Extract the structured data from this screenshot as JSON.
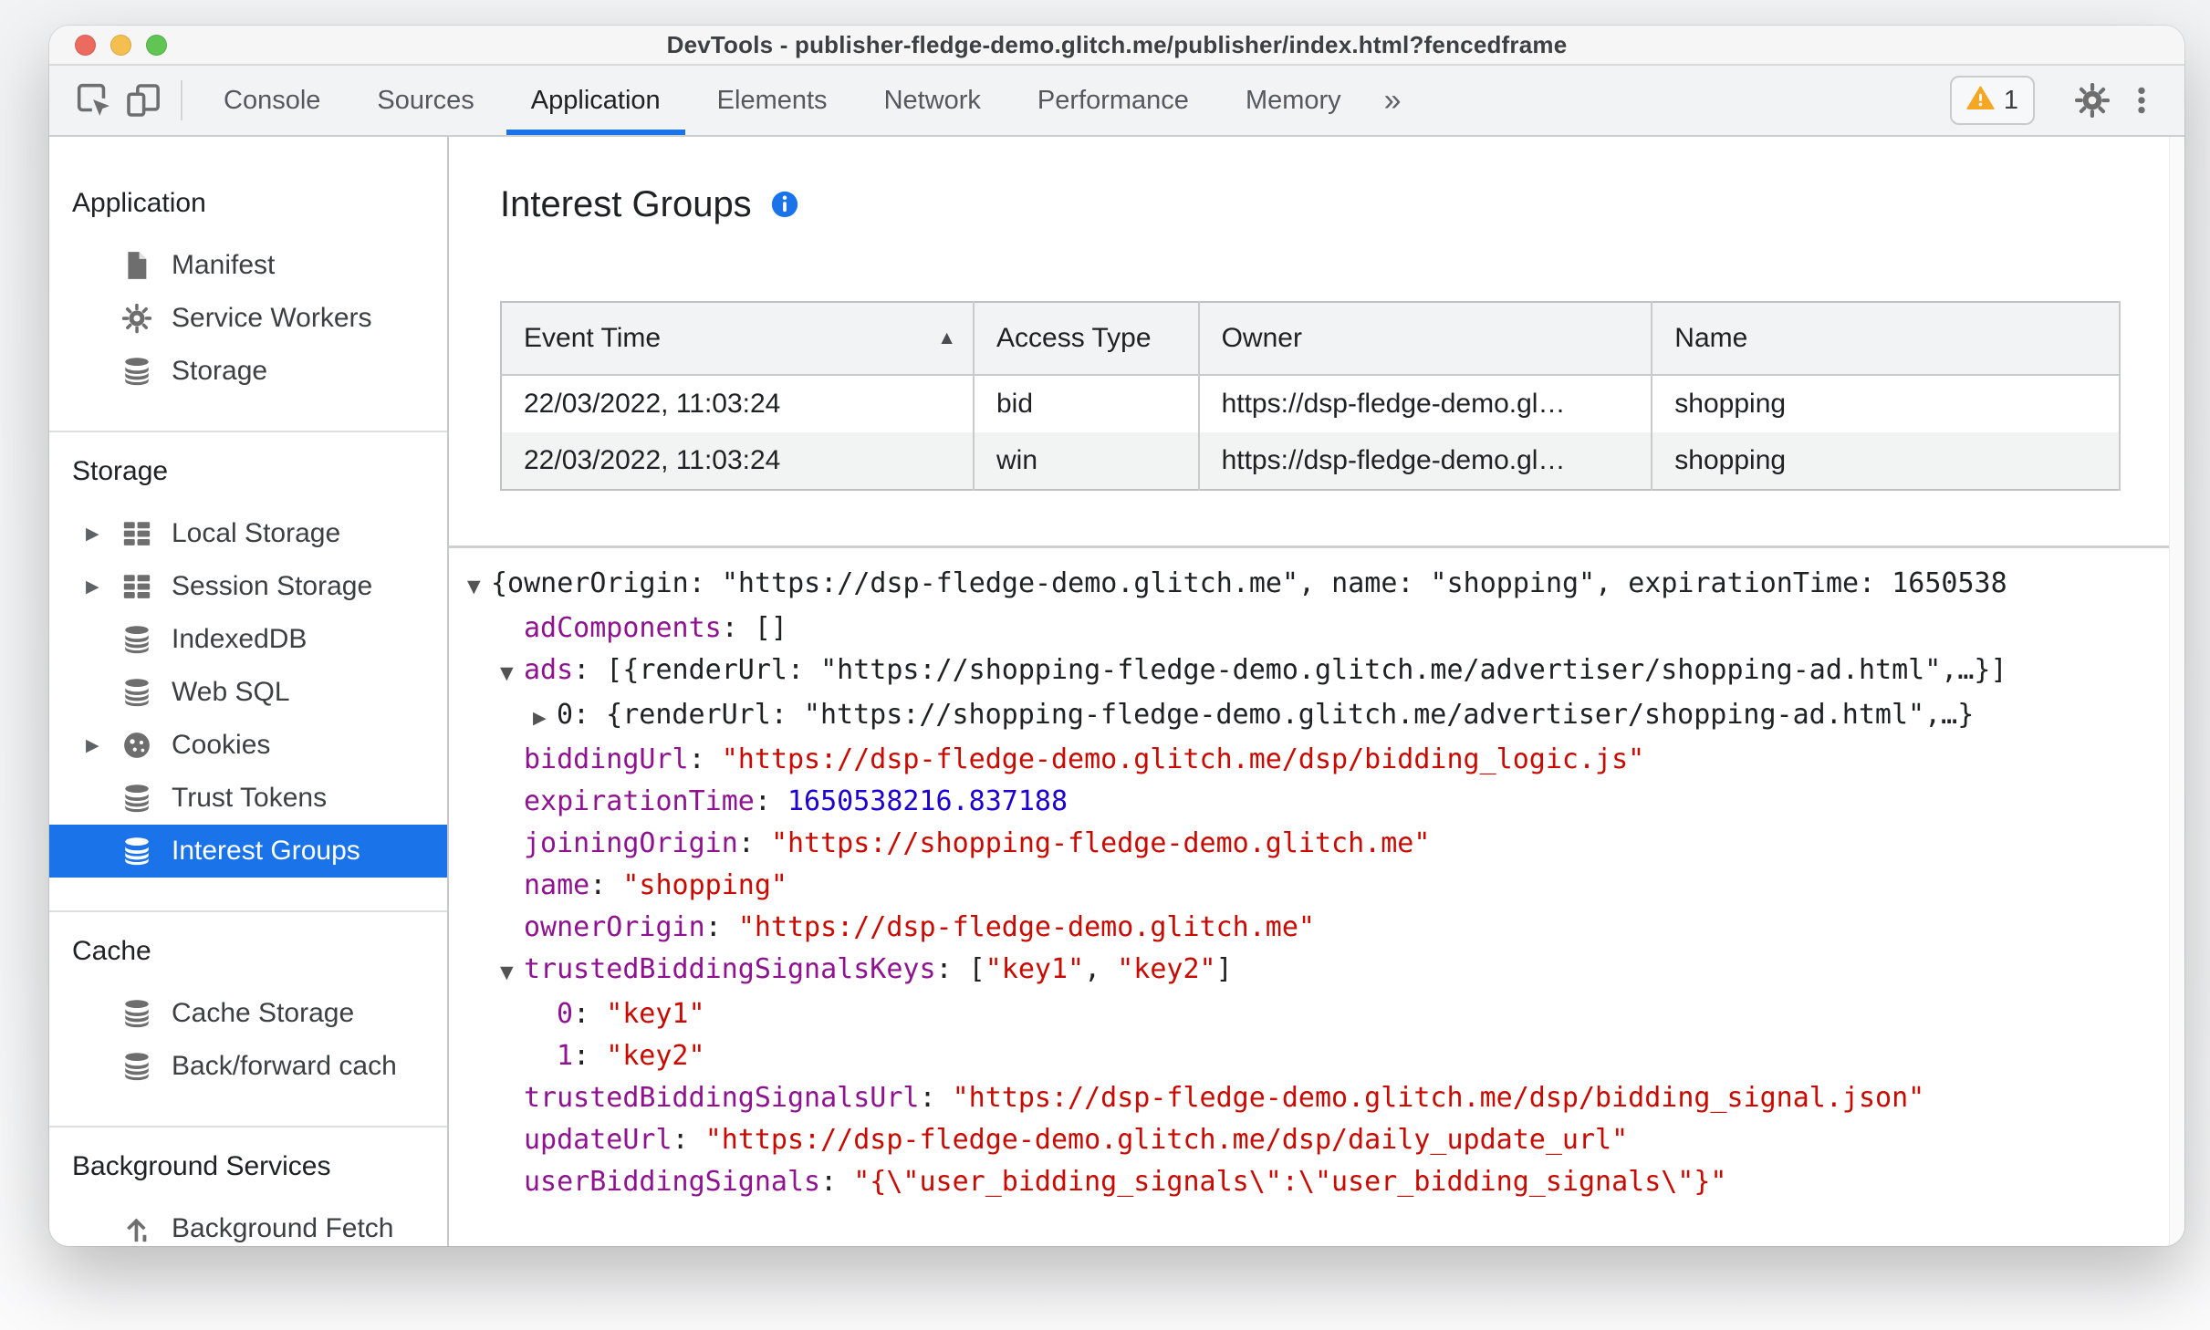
{
  "colors": {
    "accent": "#1a73e8",
    "warning": "#f5a623",
    "key_purple": "#8f1391",
    "string_red": "#c80a00",
    "number_blue": "#1c00cf",
    "selected_bg": "#1a73e8"
  },
  "window": {
    "title": "DevTools - publisher-fledge-demo.glitch.me/publisher/index.html?fencedframe",
    "traffic_lights": [
      {
        "name": "close",
        "color": "#ed6a5e"
      },
      {
        "name": "minimize",
        "color": "#f4bf4f"
      },
      {
        "name": "zoom",
        "color": "#61c554"
      }
    ]
  },
  "toolbar": {
    "tabs": [
      {
        "label": "Console",
        "active": false
      },
      {
        "label": "Sources",
        "active": false
      },
      {
        "label": "Application",
        "active": true
      },
      {
        "label": "Elements",
        "active": false
      },
      {
        "label": "Network",
        "active": false
      },
      {
        "label": "Performance",
        "active": false
      },
      {
        "label": "Memory",
        "active": false
      }
    ],
    "more_tabs_label": "»",
    "warning_count": "1"
  },
  "sidebar": {
    "sections": [
      {
        "title": "Application",
        "items": [
          {
            "label": "Manifest",
            "icon": "file-icon"
          },
          {
            "label": "Service Workers",
            "icon": "gear-icon"
          },
          {
            "label": "Storage",
            "icon": "database-icon"
          }
        ]
      },
      {
        "title": "Storage",
        "items": [
          {
            "label": "Local Storage",
            "icon": "table-icon",
            "expander": true
          },
          {
            "label": "Session Storage",
            "icon": "table-icon",
            "expander": true
          },
          {
            "label": "IndexedDB",
            "icon": "database-icon"
          },
          {
            "label": "Web SQL",
            "icon": "database-icon"
          },
          {
            "label": "Cookies",
            "icon": "cookie-icon",
            "expander": true
          },
          {
            "label": "Trust Tokens",
            "icon": "database-icon"
          },
          {
            "label": "Interest Groups",
            "icon": "database-icon",
            "selected": true
          }
        ]
      },
      {
        "title": "Cache",
        "items": [
          {
            "label": "Cache Storage",
            "icon": "database-icon"
          },
          {
            "label": "Back/forward cach",
            "icon": "database-icon"
          }
        ]
      },
      {
        "title": "Background Services",
        "items": [
          {
            "label": "Background Fetch",
            "icon": "fetch-icon"
          }
        ]
      }
    ]
  },
  "main": {
    "heading": "Interest Groups",
    "table": {
      "columns": [
        {
          "label": "Event Time",
          "sorted": "asc"
        },
        {
          "label": "Access Type"
        },
        {
          "label": "Owner"
        },
        {
          "label": "Name"
        }
      ],
      "rows": [
        [
          "22/03/2022, 11:03:24",
          "bid",
          "https://dsp-fledge-demo.gl…",
          "shopping"
        ],
        [
          "22/03/2022, 11:03:24",
          "win",
          "https://dsp-fledge-demo.gl…",
          "shopping"
        ]
      ]
    },
    "tree": {
      "lines": [
        {
          "indent": 0,
          "expander": "open",
          "segments": [
            [
              "p",
              "{ownerOrigin: \"https://dsp-fledge-demo.glitch.me\", name: \"shopping\", expirationTime: 1650538"
            ]
          ]
        },
        {
          "indent": 1,
          "expander": "none",
          "segments": [
            [
              "k",
              "adComponents"
            ],
            [
              "p",
              ": []"
            ]
          ]
        },
        {
          "indent": 1,
          "expander": "open",
          "segments": [
            [
              "k",
              "ads"
            ],
            [
              "p",
              ": [{renderUrl: \"https://shopping-fledge-demo.glitch.me/advertiser/shopping-ad.html\",…}]"
            ]
          ]
        },
        {
          "indent": 2,
          "expander": "closed",
          "segments": [
            [
              "p",
              "0: {renderUrl: \"https://shopping-fledge-demo.glitch.me/advertiser/shopping-ad.html\",…}"
            ]
          ]
        },
        {
          "indent": 1,
          "expander": "none",
          "segments": [
            [
              "k",
              "biddingUrl"
            ],
            [
              "p",
              ": "
            ],
            [
              "s",
              "\"https://dsp-fledge-demo.glitch.me/dsp/bidding_logic.js\""
            ]
          ]
        },
        {
          "indent": 1,
          "expander": "none",
          "segments": [
            [
              "k",
              "expirationTime"
            ],
            [
              "p",
              ": "
            ],
            [
              "n",
              "1650538216.837188"
            ]
          ]
        },
        {
          "indent": 1,
          "expander": "none",
          "segments": [
            [
              "k",
              "joiningOrigin"
            ],
            [
              "p",
              ": "
            ],
            [
              "s",
              "\"https://shopping-fledge-demo.glitch.me\""
            ]
          ]
        },
        {
          "indent": 1,
          "expander": "none",
          "segments": [
            [
              "k",
              "name"
            ],
            [
              "p",
              ": "
            ],
            [
              "s",
              "\"shopping\""
            ]
          ]
        },
        {
          "indent": 1,
          "expander": "none",
          "segments": [
            [
              "k",
              "ownerOrigin"
            ],
            [
              "p",
              ": "
            ],
            [
              "s",
              "\"https://dsp-fledge-demo.glitch.me\""
            ]
          ]
        },
        {
          "indent": 1,
          "expander": "open",
          "segments": [
            [
              "k",
              "trustedBiddingSignalsKeys"
            ],
            [
              "p",
              ": ["
            ],
            [
              "s",
              "\"key1\""
            ],
            [
              "p",
              ", "
            ],
            [
              "s",
              "\"key2\""
            ],
            [
              "p",
              "]"
            ]
          ]
        },
        {
          "indent": 2,
          "expander": "none",
          "segments": [
            [
              "k",
              "0"
            ],
            [
              "p",
              ": "
            ],
            [
              "s",
              "\"key1\""
            ]
          ]
        },
        {
          "indent": 2,
          "expander": "none",
          "segments": [
            [
              "k",
              "1"
            ],
            [
              "p",
              ": "
            ],
            [
              "s",
              "\"key2\""
            ]
          ]
        },
        {
          "indent": 1,
          "expander": "none",
          "segments": [
            [
              "k",
              "trustedBiddingSignalsUrl"
            ],
            [
              "p",
              ": "
            ],
            [
              "s",
              "\"https://dsp-fledge-demo.glitch.me/dsp/bidding_signal.json\""
            ]
          ]
        },
        {
          "indent": 1,
          "expander": "none",
          "segments": [
            [
              "k",
              "updateUrl"
            ],
            [
              "p",
              ": "
            ],
            [
              "s",
              "\"https://dsp-fledge-demo.glitch.me/dsp/daily_update_url\""
            ]
          ]
        },
        {
          "indent": 1,
          "expander": "none",
          "segments": [
            [
              "k",
              "userBiddingSignals"
            ],
            [
              "p",
              ": "
            ],
            [
              "s",
              "\"{\\\"user_bidding_signals\\\":\\\"user_bidding_signals\\\"}\""
            ]
          ]
        }
      ]
    }
  }
}
